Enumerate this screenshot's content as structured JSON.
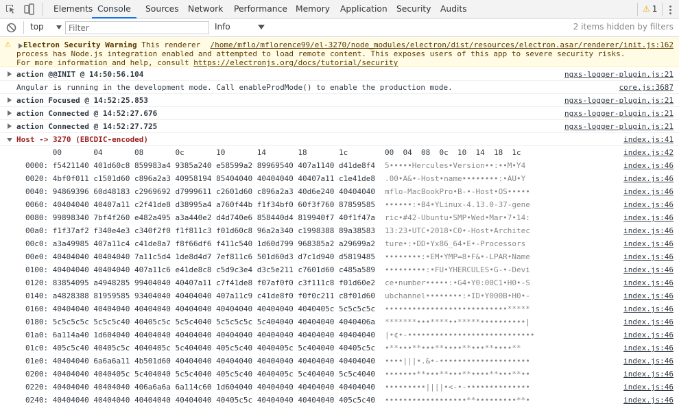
{
  "toolbar": {
    "tabs": [
      "Elements",
      "Console",
      "Sources",
      "Network",
      "Performance",
      "Memory",
      "Application",
      "Security",
      "Audits"
    ],
    "active_tab": "Console",
    "warning_count": "1"
  },
  "filterbar": {
    "context": "top",
    "filter_placeholder": "Filter",
    "levels": "Info",
    "hidden_items": "2 items hidden by filters"
  },
  "warning": {
    "title": "Electron Security Warning",
    "line1_rest": " This renderer  /home/mflo/mflorence99/el-3270/node_modules/electron/dist/resources/electron.asar/renderer/init.js:162",
    "source": "/home/mflo/mflorence99/el-3270/node_modules/electron/dist/resources/electron.asar/renderer/init.js:162",
    "line2": "process has Node.js integration enabled and attempted to load remote content. This exposes users of this app to severe security risks.",
    "line3_prefix": "For more information and help, consult ",
    "link": "https://electronjs.org/docs/tutorial/security"
  },
  "messages": [
    {
      "text": "action @@INIT @ 14:50:56.104",
      "source": "ngxs-logger-plugin.js:21"
    },
    {
      "text": "Angular is running in the development mode. Call enableProdMode() to enable the production mode.",
      "source": "core.js:3687"
    },
    {
      "text": "action Focused @ 14:52:25.853",
      "source": "ngxs-logger-plugin.js:21"
    },
    {
      "text": "action Connected @ 14:52:27.676",
      "source": "ngxs-logger-plugin.js:21"
    },
    {
      "text": "action Connected @ 14:52:27.725",
      "source": "ngxs-logger-plugin.js:21"
    },
    {
      "text": "Host -> 3270 (EBCDIC-encoded)",
      "source": "index.js:41"
    }
  ],
  "hexdump": {
    "header_hex": "      00       04       08       0c       10       14       18       1c",
    "header_ascii": "00  04  08  0c  10  14  18  1c",
    "header_source": "index.js:42",
    "row_source": "index.js:46",
    "rows": [
      {
        "hex": "0000: f5421140 401d60c8 859983a4 9385a240 e58599a2 89969540 407a1140 d41de8f4",
        "ascii": "5•••••Hercules•Version••:••M•Y4"
      },
      {
        "hex": "0020: 4bf0f011 c1501d60 c896a2a3 40958194 85404040 40404040 40407a11 c1e41de8",
        "ascii": ".00•A&•-Host•name••••••••:•AU•Y"
      },
      {
        "hex": "0040: 94869396 60d48183 c2969692 d7999611 c2601d60 c896a2a3 40d6e240 40404040",
        "ascii": "mflo-MacBookPro•B-•-Host•OS•••••"
      },
      {
        "hex": "0060: 40404040 40407a11 c2f41de8 d38995a4 a760f44b f1f34bf0 60f3f760 87859585",
        "ascii": "••••••:•B4•YLinux-4.13.0-37-gene"
      },
      {
        "hex": "0080: 99898340 7bf4f260 e482a495 a3a440e2 d4d740e6 858440d4 819940f7 40f1f47a",
        "ascii": "ric•#42-Ubuntu•SMP•Wed•Mar•7•14:"
      },
      {
        "hex": "00a0: f1f37af2 f340e4e3 c340f2f0 f1f811c3 f01d60c8 96a2a340 c1998388 89a38583",
        "ascii": "13:23•UTC•2018•C0•-Host•Architec"
      },
      {
        "hex": "00c0: a3a49985 407a11c4 c41de8a7 f8f66df6 f411c540 1d60d799 968385a2 a29699a2",
        "ascii": "ture•:•DD•Yx86_64•E•-Processors"
      },
      {
        "hex": "00e0: 40404040 40404040 7a11c5d4 1de8d4d7 7ef811c6 501d60d3 d7c1d940 d5819485",
        "ascii": "••••••••:•EM•YMP=8•F&•-LPAR•Name"
      },
      {
        "hex": "0100: 40404040 40404040 407a11c6 e41de8c8 c5d9c3e4 d3c5e211 c7601d60 c485a589",
        "ascii": "•••••••••:•FU•YHERCULES•G-•-Devi"
      },
      {
        "hex": "0120: 83854095 a4948285 99404040 40407a11 c7f41de8 f07af0f0 c3f111c8 f01d60e2",
        "ascii": "ce•number•••••:•G4•Y0:00C1•H0•-S"
      },
      {
        "hex": "0140: a4828388 81959585 93404040 40404040 407a11c9 c41de8f0 f0f0c211 c8f01d60",
        "ascii": "ubchannel••••••••:•ID•Y000B•H0•-"
      },
      {
        "hex": "0160: 40404040 40404040 40404040 40404040 40404040 40404040 4040405c 5c5c5c5c",
        "ascii": "•••••••••••••••••••••••••••*****"
      },
      {
        "hex": "0180: 5c5c5c5c 5c5c5c40 40405c5c 5c5c4040 5c5c5c5c 5c404040 40404040 4040406a",
        "ascii": "*******•••****••*****••••••••••|"
      },
      {
        "hex": "01a0: 6a114a40 1d604040 40404040 40404040 40404040 40404040 40404040 40404040",
        "ascii": "|•¢•-••••••••••••••••••••••••••••"
      },
      {
        "hex": "01c0: 405c5c40 40405c5c 4040405c 5c404040 405c5c40 4040405c 5c404040 40405c5c",
        "ascii": "•**•••**•••**••••**•••**••••**"
      },
      {
        "hex": "01e0: 40404040 6a6a6a11 4b501d60 40404040 40404040 40404040 40404040 40404040",
        "ascii": "••••|||•.&•-••••••••••••••••••••"
      },
      {
        "hex": "0200: 40404040 4040405c 5c404040 5c5c4040 405c5c40 4040405c 5c404040 5c5c4040",
        "ascii": "•••••••**•••**•••**••••**•••**••"
      },
      {
        "hex": "0220: 40404040 40404040 406a6a6a 6a114c60 1d604040 40404040 40404040 40404040",
        "ascii": "•••••••••||||•<-•-••••••••••••••"
      },
      {
        "hex": "0240: 40404040 40404040 40404040 40404040 40405c5c 40404040 40404040 405c5c40",
        "ascii": "••••••••••••••••••**•••••••••**•"
      }
    ]
  }
}
